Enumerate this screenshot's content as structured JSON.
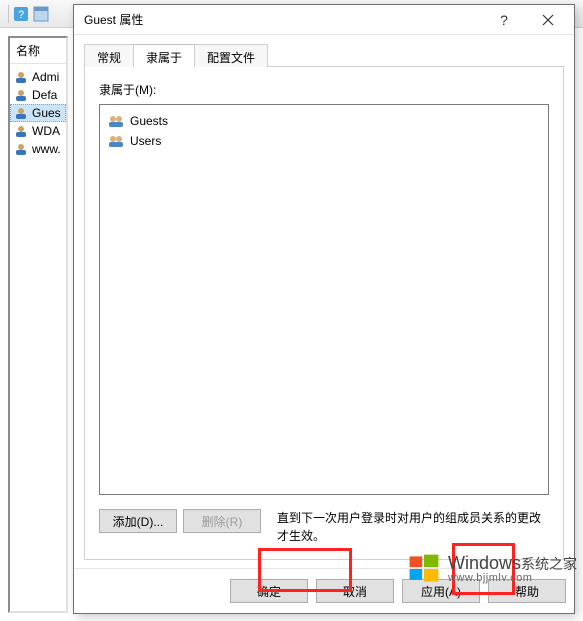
{
  "background": {
    "column_header": "名称",
    "items": [
      {
        "label": "Admi"
      },
      {
        "label": "Defa"
      },
      {
        "label": "Gues",
        "selected": true
      },
      {
        "label": "WDA"
      },
      {
        "label": "www."
      }
    ]
  },
  "dialog": {
    "title": "Guest 属性",
    "tabs": {
      "general": "常规",
      "memberof": "隶属于",
      "profile": "配置文件",
      "activeIndex": 1
    },
    "memberof_page": {
      "label": "隶属于(M):",
      "groups": [
        {
          "name": "Guests"
        },
        {
          "name": "Users"
        }
      ],
      "add_label": "添加(D)...",
      "remove_label": "删除(R)",
      "note": "直到下一次用户登录时对用户的组成员关系的更改才生效。"
    },
    "buttons": {
      "ok": "确定",
      "cancel": "取消",
      "apply": "应用(A)",
      "help": "帮助"
    }
  },
  "watermark": {
    "brand": "Windows",
    "suffix": "系统之家",
    "url": "www.bjjmlv.com"
  }
}
